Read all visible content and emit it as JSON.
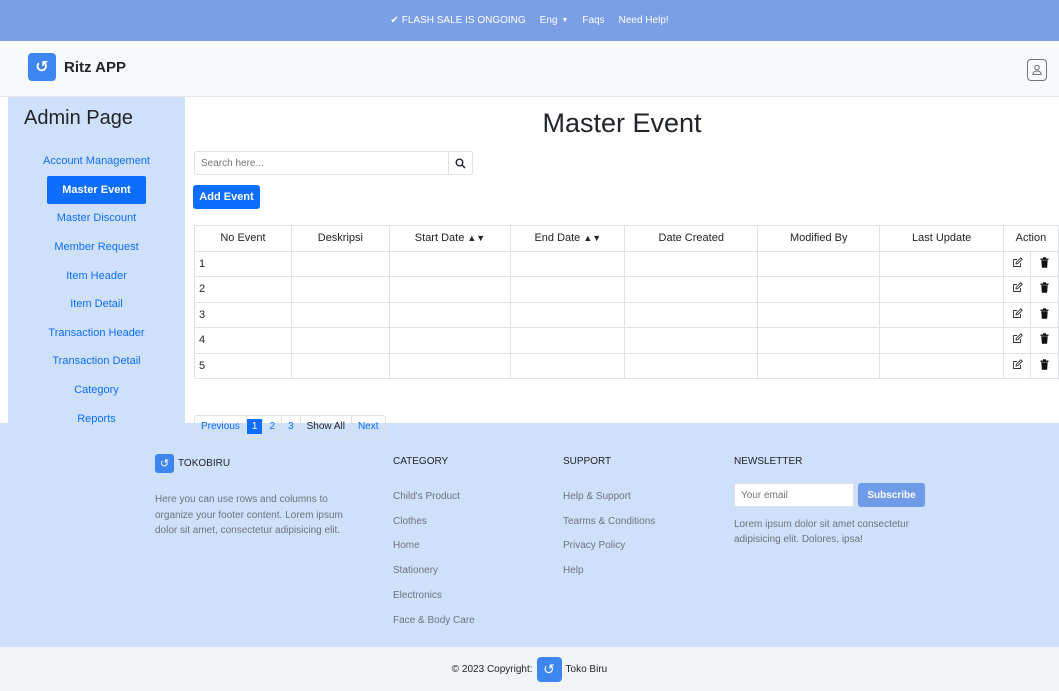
{
  "topbar": {
    "flash_text": "FLASH SALE IS ONGOING",
    "lang": "Eng",
    "faqs": "Faqs",
    "help": "Need Help!"
  },
  "navbar": {
    "brand": "Ritz APP"
  },
  "sidebar": {
    "title": "Admin Page",
    "items": [
      {
        "label": "Account Management"
      },
      {
        "label": "Master Event",
        "active": true
      },
      {
        "label": "Master Discount"
      },
      {
        "label": "Member Request"
      },
      {
        "label": "Item Header"
      },
      {
        "label": "Item Detail"
      },
      {
        "label": "Transaction Header"
      },
      {
        "label": "Transaction Detail"
      },
      {
        "label": "Category"
      },
      {
        "label": "Reports"
      }
    ]
  },
  "main": {
    "title": "Master Event",
    "search_placeholder": "Search here...",
    "add_button": "Add Event",
    "columns": [
      "No Event",
      "Deskripsi",
      "Start Date",
      "End Date",
      "Date Created",
      "Modified By",
      "Last Update",
      "Action"
    ],
    "rows": [
      {
        "no": "1"
      },
      {
        "no": "2"
      },
      {
        "no": "3"
      },
      {
        "no": "4"
      },
      {
        "no": "5"
      }
    ],
    "pagination": {
      "previous": "Previous",
      "pages": [
        "1",
        "2",
        "3"
      ],
      "current": "1",
      "show_all": "Show All",
      "next": "Next"
    }
  },
  "footer": {
    "brand": "TOKOBIRU",
    "description": "Here you can use rows and columns to organize your footer content. Lorem ipsum dolor sit amet, consectetur adipisicing elit.",
    "category_title": "CATEGORY",
    "categories": [
      "Child's Product",
      "Clothes",
      "Home",
      "Stationery",
      "Electronics",
      "Face & Body Care"
    ],
    "support_title": "SUPPORT",
    "support_links": [
      "Help & Support",
      "Tearms & Conditions",
      "Privacy Policy",
      "Help"
    ],
    "newsletter_title": "NEWSLETTER",
    "email_placeholder": "Your email",
    "subscribe": "Subscribe",
    "newsletter_desc": "Lorem ipsum dolor sit amet consectetur adipisicing elit. Dolores, ipsa!"
  },
  "copyright": {
    "text": "© 2023 Copyright:",
    "brand": "Toko Biru"
  },
  "colors": {
    "primary": "#0d6efd",
    "topbar": "#7a9fe6",
    "sidebar": "#cfe0fb",
    "footer": "#cfe0fb"
  },
  "icons": [
    "check-icon",
    "caret-down-icon",
    "exclamation-icon",
    "bag-logo-icon",
    "user-icon",
    "search-icon",
    "sort-icon",
    "edit-icon",
    "trash-icon"
  ]
}
